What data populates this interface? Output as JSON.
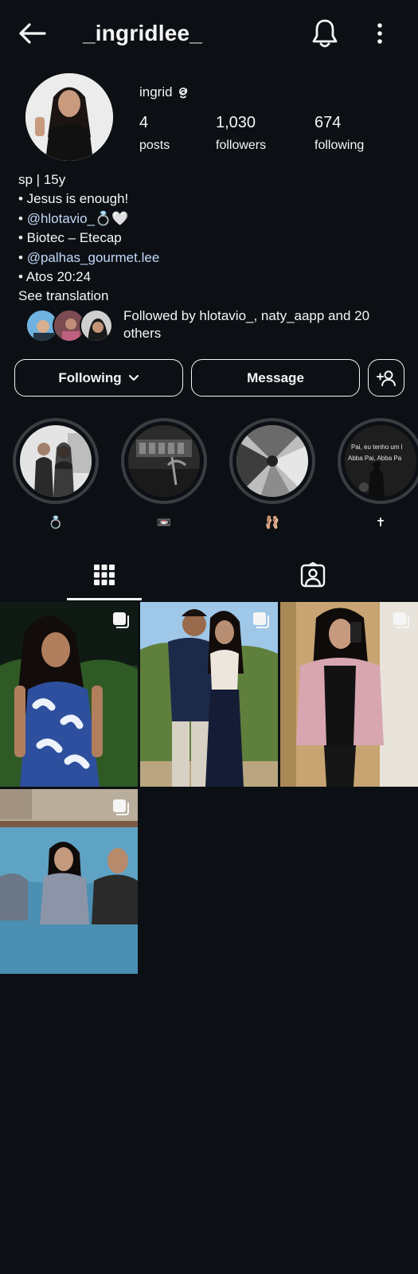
{
  "header": {
    "username": "_ingridlee_"
  },
  "profile": {
    "display_name": "ingrid",
    "stats": [
      {
        "value": "4",
        "label": "posts"
      },
      {
        "value": "1,030",
        "label": "followers"
      },
      {
        "value": "674",
        "label": "following"
      }
    ],
    "bio": {
      "line1": "sp | 15y",
      "line2": "• Jesus is enough!",
      "line3_prefix": "• ",
      "line3_link": "@hlotavio_",
      "line3_suffix": "💍🤍",
      "line4": "• Biotec – Etecap",
      "line5_prefix": "• ",
      "line5_link": "@palhas_gourmet.lee",
      "line6": "• Atos 20:24",
      "see_translation": "See translation"
    },
    "followed_by": "Followed by hlotavio_, naty_aapp and 20 others"
  },
  "actions": {
    "following_label": "Following",
    "message_label": "Message"
  },
  "highlights": [
    {
      "label": "💍"
    },
    {
      "label": "📼"
    },
    {
      "label": "🩰"
    },
    {
      "label": "✝"
    }
  ],
  "highlight_texts": {
    "h4_line1": "Pai, eu tenho um l",
    "h4_line2": "Abba Pai, Abba Pa"
  },
  "icons": {
    "back": "arrow-left-icon",
    "bell": "bell-icon",
    "more": "more-vertical-icon",
    "chevron": "chevron-down-icon",
    "add_person": "add-person-icon",
    "grid_tab": "grid-icon",
    "tagged_tab": "tagged-person-icon",
    "multi": "multiple-photos-icon"
  },
  "colors": {
    "background": "#0c1014",
    "text": "#f5f5f5",
    "link": "#c3d9fb"
  }
}
